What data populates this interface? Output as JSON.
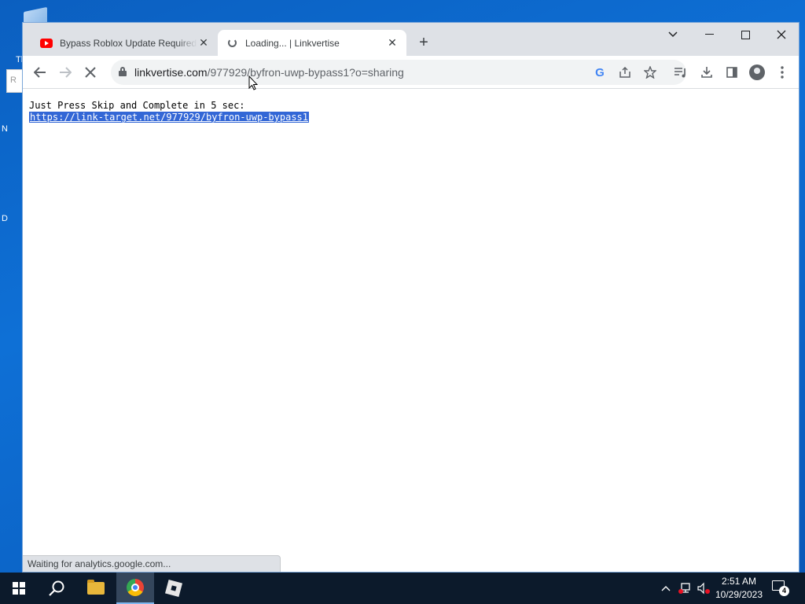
{
  "desktop": {
    "icon_label": "Th",
    "left_letters": [
      "N",
      "D"
    ],
    "back_window_letter": "R"
  },
  "browser": {
    "tabs": [
      {
        "title": "Bypass Roblox Update Required",
        "favicon": "youtube-icon",
        "active": false
      },
      {
        "title": "Loading... | Linkvertise",
        "favicon": "loading-spinner-icon",
        "active": true
      }
    ],
    "new_tab_label": "+",
    "address": {
      "host": "linkvertise.com",
      "path": "/977929/byfron-uwp-bypass1?o=sharing"
    },
    "page": {
      "line1": "Just Press Skip and Complete in 5 sec:",
      "line2": "https://link-target.net/977929/byfron-uwp-bypass1"
    },
    "status": "Waiting for analytics.google.com..."
  },
  "taskbar": {
    "time": "2:51 AM",
    "date": "10/29/2023",
    "notification_count": "4",
    "accent": "#7fb7ef"
  }
}
